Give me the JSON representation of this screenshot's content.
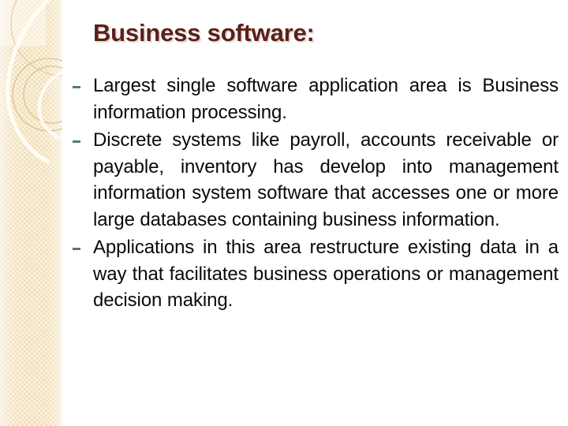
{
  "slide": {
    "title": "Business software:",
    "title_color": "#5b2018",
    "background_color": "#ffffff",
    "sidebar": {
      "name": "decorative-sidebar",
      "base_color": "#f2e0b9",
      "highlight_color": "#f9efd7",
      "arc_color": "#d8bd8e"
    },
    "bullets": [
      {
        "marker": "-",
        "marker_color": "#55767c",
        "text": "Largest single software application area is Business information processing."
      },
      {
        "marker": "-",
        "marker_color": "#55767c",
        "text": "Discrete systems like payroll, accounts receivable or payable, inventory has develop into management information system software that accesses one or more large databases containing business information."
      },
      {
        "marker": "-",
        "marker_color": "#55767c",
        "text": "Applications in this area restructure existing data in a way that facilitates business operations or management decision making."
      }
    ]
  }
}
